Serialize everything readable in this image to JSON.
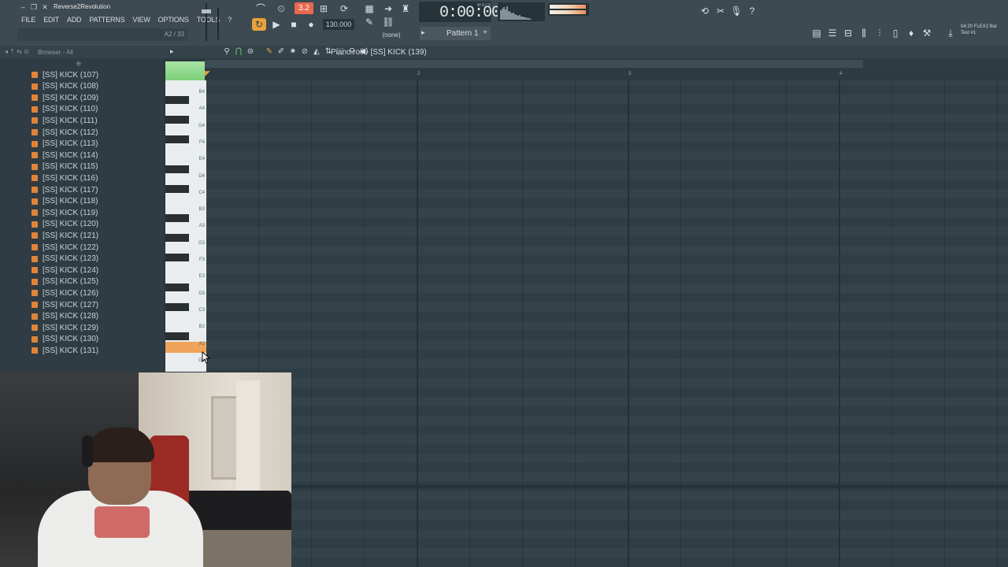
{
  "window": {
    "title": "Reverse2Revolution",
    "controls": [
      "minimize",
      "restore",
      "close"
    ]
  },
  "menu": [
    "FILE",
    "EDIT",
    "ADD",
    "PATTERNS",
    "VIEW",
    "OPTIONS",
    "TOOLS",
    "?"
  ],
  "hint": {
    "text": "A2 / 33"
  },
  "transport": {
    "bpm_badge": "3.2",
    "tempo": "130.000",
    "time": "0:00:00",
    "time_unit": "M:S:CS",
    "snap": "(none)"
  },
  "pattern": {
    "label": "Pattern 1"
  },
  "status": {
    "line1": "04:20  FLEX2 Bar",
    "line2": "Test #1"
  },
  "browser": {
    "title": "Browser - All",
    "items": [
      "[SS] KICK (107)",
      "[SS] KICK (108)",
      "[SS] KICK (109)",
      "[SS] KICK (110)",
      "[SS] KICK (111)",
      "[SS] KICK (112)",
      "[SS] KICK (113)",
      "[SS] KICK (114)",
      "[SS] KICK (115)",
      "[SS] KICK (116)",
      "[SS] KICK (117)",
      "[SS] KICK (118)",
      "[SS] KICK (119)",
      "[SS] KICK (120)",
      "[SS] KICK (121)",
      "[SS] KICK (122)",
      "[SS] KICK (123)",
      "[SS] KICK (124)",
      "[SS] KICK (125)",
      "[SS] KICK (126)",
      "[SS] KICK (127)",
      "[SS] KICK (128)",
      "[SS] KICK (129)",
      "[SS] KICK (130)",
      "[SS] KICK (131)"
    ]
  },
  "piano_roll": {
    "title": "Piano roll - [SS] KICK (139)",
    "bar_numbers": [
      "2",
      "3",
      "4"
    ],
    "keys": [
      "B4",
      "A4",
      "G4",
      "F4",
      "E4",
      "D4",
      "C4",
      "B3",
      "A3",
      "G3",
      "F3",
      "E3",
      "D3",
      "C3",
      "B2",
      "A2",
      "G2"
    ],
    "highlighted_key": "A2",
    "highlight_color": "#f0a35a"
  },
  "colors": {
    "accent_orange": "#e6a23c",
    "record_red": "#e8684e",
    "browser_icon": "#e0843a"
  }
}
